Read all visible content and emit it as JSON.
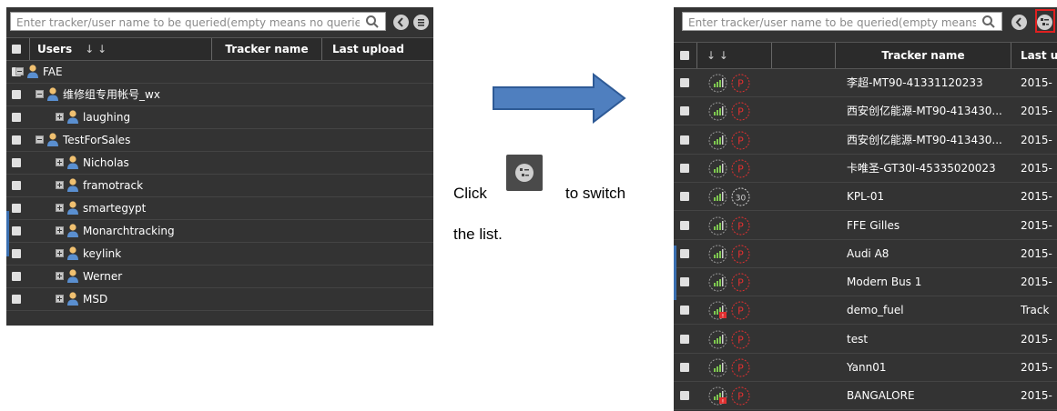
{
  "left_panel": {
    "search_placeholder": "Enter tracker/user name to be queried(empty means no queried)",
    "columns": {
      "users": "Users",
      "sort_icons": "↓  ↓",
      "tracker_name": "Tracker name",
      "last_upload": "Last upload"
    },
    "tree": [
      {
        "label": "FAE",
        "level": 0,
        "state": "expanded"
      },
      {
        "label": "维修组专用帐号_wx",
        "level": 1,
        "state": "expanded"
      },
      {
        "label": "laughing",
        "level": 2,
        "state": "collapsed"
      },
      {
        "label": "TestForSales",
        "level": 1,
        "state": "expanded"
      },
      {
        "label": "Nicholas",
        "level": 2,
        "state": "collapsed"
      },
      {
        "label": "framotrack",
        "level": 2,
        "state": "collapsed"
      },
      {
        "label": "smartegypt",
        "level": 2,
        "state": "collapsed"
      },
      {
        "label": "Monarchtracking",
        "level": 2,
        "state": "collapsed"
      },
      {
        "label": "keylink",
        "level": 2,
        "state": "collapsed"
      },
      {
        "label": "Werner",
        "level": 2,
        "state": "collapsed"
      },
      {
        "label": "MSD",
        "level": 2,
        "state": "collapsed"
      }
    ]
  },
  "middle": {
    "caption_click": "Click",
    "caption_to_switch": "to  switch",
    "caption_the_list": "the list.",
    "arrow_color": "#4f7fbf"
  },
  "right_panel": {
    "search_placeholder": "Enter tracker/user name to be queried(empty means",
    "columns": {
      "sort_icons": "↓  ↓",
      "tracker_name": "Tracker name",
      "last_upload": "Last u"
    },
    "rows": [
      {
        "name": "李超-MT90-41331120233",
        "last": "2015-",
        "status": "P",
        "alert": false
      },
      {
        "name": "西安创亿能源-MT90-413430...",
        "last": "2015-",
        "status": "P",
        "alert": false
      },
      {
        "name": "西安创亿能源-MT90-413430...",
        "last": "2015-",
        "status": "P",
        "alert": false
      },
      {
        "name": "卡唯圣-GT30I-45335020023",
        "last": "2015-",
        "status": "P",
        "alert": false
      },
      {
        "name": "KPL-01",
        "last": "2015-",
        "status": "30",
        "alert": false
      },
      {
        "name": "FFE Gilles",
        "last": "2015-",
        "status": "P",
        "alert": false
      },
      {
        "name": "Audi A8",
        "last": "2015-",
        "status": "P",
        "alert": false
      },
      {
        "name": "Modern Bus 1",
        "last": "2015-",
        "status": "P",
        "alert": false
      },
      {
        "name": "demo_fuel",
        "last": "Track",
        "status": "P",
        "alert": true
      },
      {
        "name": "test",
        "last": "2015-",
        "status": "P",
        "alert": false
      },
      {
        "name": "Yann01",
        "last": "2015-",
        "status": "P",
        "alert": false
      },
      {
        "name": "BANGALORE",
        "last": "2015-",
        "status": "P",
        "alert": true
      }
    ]
  },
  "colors": {
    "panel": "#333333",
    "header": "#2b2b2b",
    "signal_green": "#7ec850",
    "status_red": "#e03030",
    "highlight": "#e02020"
  }
}
